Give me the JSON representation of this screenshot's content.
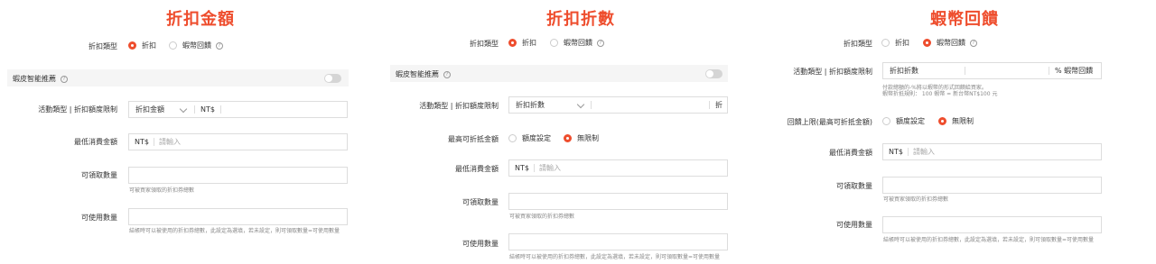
{
  "p1": {
    "title": "折扣金額",
    "type_label": "折扣類型",
    "opt_discount": "折扣",
    "opt_cashback": "蝦幣回饋",
    "smart_label": "蝦皮智能推薦",
    "activity_label": "活動類型 | 折扣額度限制",
    "activity_select": "折扣金額",
    "activity_currency": "NT$",
    "min_label": "最低消費金額",
    "min_currency": "NT$",
    "min_placeholder": "請輸入",
    "claim_label": "可領取數量",
    "claim_hint": "可被買家領取的折扣券總數",
    "use_label": "可使用數量",
    "use_hint": "結帳時可以被使用的折扣券總數，此設定為選填，若未設定，則可領取數量=可使用數量"
  },
  "p2": {
    "title": "折扣折數",
    "type_label": "折扣類型",
    "opt_discount": "折扣",
    "opt_cashback": "蝦幣回饋",
    "smart_label": "蝦皮智能推薦",
    "activity_label": "活動類型 | 折扣額度限制",
    "activity_select": "折扣折數",
    "activity_suffix": "折",
    "max_label": "最高可折抵金額",
    "max_opt1": "額度設定",
    "max_opt2": "無限制",
    "min_label": "最低消費金額",
    "min_currency": "NT$",
    "min_placeholder": "請輸入",
    "claim_label": "可領取數量",
    "claim_hint": "可被買家領取的折扣券總數",
    "use_label": "可使用數量",
    "use_hint": "結帳時可以被使用的折扣券總數，此設定為選填，若未設定，則可領取數量=可使用數量"
  },
  "p3": {
    "title": "蝦幣回饋",
    "type_label": "折扣類型",
    "opt_discount": "折扣",
    "opt_cashback": "蝦幣回饋",
    "activity_label": "活動類型 | 折扣額度限制",
    "activity_select": "折扣折數",
    "activity_suffix": "% 蝦幣回饋",
    "activity_hint1": "付款總額的-%將以蝦幣的形式回饋給買家。",
    "activity_hint2": "蝦幣折抵規則： 100 蝦幣 = 新台幣NT$100 元",
    "cap_label": "回饋上限(最高可折抵金額)",
    "cap_opt1": "額度設定",
    "cap_opt2": "無限制",
    "min_label": "最低消費金額",
    "min_currency": "NT$",
    "min_placeholder": "請輸入",
    "claim_label": "可領取數量",
    "claim_hint": "可被買家領取的折扣券總數",
    "use_label": "可使用數量",
    "use_hint": "結帳時可以被使用的折扣券總數，此設定為選填，若未設定，則可領取數量=可使用數量"
  },
  "colors": {
    "accent": "#ee4d2d",
    "panel": "#f5f5f5"
  },
  "icons": {
    "help": "question-circle-icon",
    "dropdown": "chevron-down-icon"
  }
}
